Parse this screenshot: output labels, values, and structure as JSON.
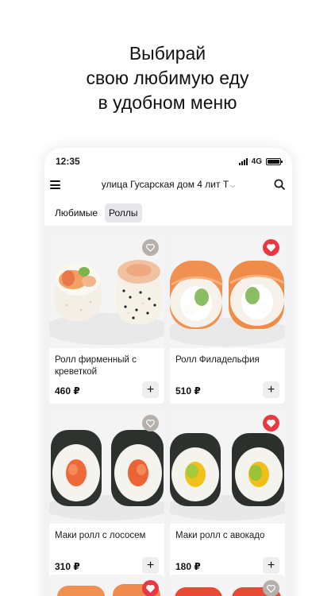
{
  "promo": {
    "line1": "Выбирай",
    "line2": "свою любимую еду",
    "line3": "в удобном меню"
  },
  "status_bar": {
    "time": "12:35",
    "network": "4G"
  },
  "app_bar": {
    "address": "улица Гусарская дом 4 лит Т",
    "address_chevron": "chevron-down-icon",
    "menu_icon": "hamburger-menu-icon",
    "search_icon": "search-icon"
  },
  "filters": [
    {
      "label": "Любимые",
      "active": false
    },
    {
      "label": "Роллы",
      "active": true
    }
  ],
  "products": [
    {
      "name": "Ролл фирменный с креветкой",
      "price": "460 ₽",
      "favorite": false,
      "image": "shrimp-roll"
    },
    {
      "name": "Ролл Филадельфия",
      "price": "510 ₽",
      "favorite": true,
      "image": "philadelphia-roll"
    },
    {
      "name": "Маки ролл с лососем",
      "price": "310 ₽",
      "favorite": false,
      "image": "salmon-maki"
    },
    {
      "name": "Маки ролл с авокадо",
      "price": "180 ₽",
      "favorite": true,
      "image": "avocado-maki"
    }
  ],
  "partial_products": [
    {
      "favorite": true
    },
    {
      "favorite": false
    }
  ],
  "add_label": "+",
  "colors": {
    "favorite_on": "#ea3744",
    "favorite_off": "#b5b0ab",
    "chip_active": "#e8e8ec",
    "background": "#f2f2f4"
  }
}
